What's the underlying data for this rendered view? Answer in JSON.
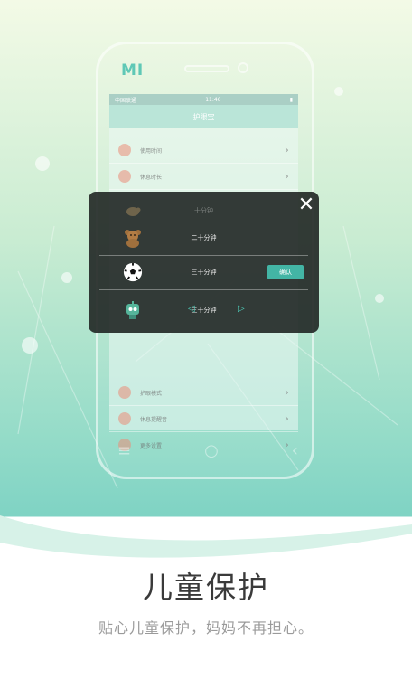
{
  "colors": {
    "accent": "#43b5a5",
    "bg_top": "#f1f9e8",
    "bg_bottom": "#7fd3c4"
  },
  "phone": {
    "logo": "MI",
    "status_left": "中国联通",
    "status_center": "11:46",
    "screen_title": "护眼宝",
    "settings_rows_top": [
      "使用时间",
      "休息时长"
    ],
    "settings_rows_bottom": [
      "护眼模式",
      "休息提醒音",
      "更多设置"
    ]
  },
  "popup": {
    "rows": [
      {
        "icon": "turtle-icon",
        "label": "十分钟"
      },
      {
        "icon": "bear-icon",
        "label": "二十分钟"
      },
      {
        "icon": "soccer-ball-icon",
        "label": "三十分钟",
        "button": "确认"
      },
      {
        "icon": "robot-icon",
        "label": "三十分钟"
      }
    ]
  },
  "headline": "儿童保护",
  "tagline": "贴心儿童保护，妈妈不再担心。"
}
